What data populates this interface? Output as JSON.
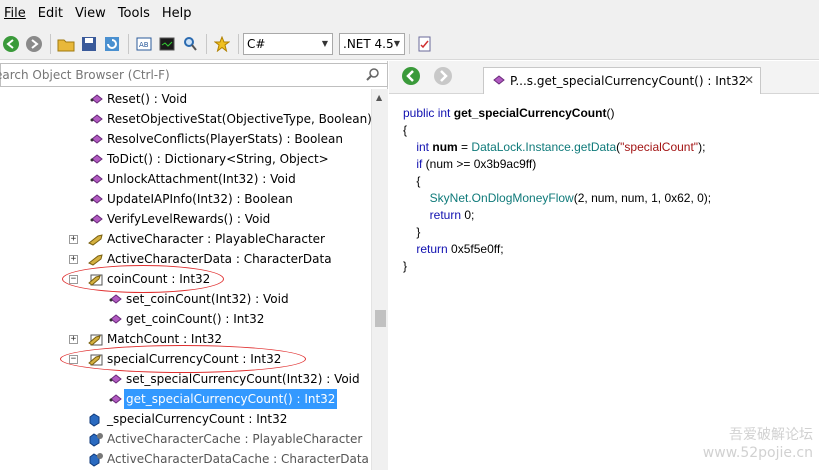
{
  "menubar": {
    "items": [
      "File",
      "Edit",
      "View",
      "Tools",
      "Help"
    ]
  },
  "toolbar": {
    "language": "C#",
    "framework": ".NET 4.5"
  },
  "search": {
    "placeholder": "earch Object Browser (Ctrl-F)"
  },
  "tree": {
    "items": [
      {
        "label": "Reset() : Void"
      },
      {
        "label": "ResetObjectiveStat(ObjectiveType, Boolean) :"
      },
      {
        "label": "ResolveConflicts(PlayerStats) : Boolean"
      },
      {
        "label": "ToDict() : Dictionary<String, Object>"
      },
      {
        "label": "UnlockAttachment(Int32) : Void"
      },
      {
        "label": "UpdateIAPInfo(Int32) : Boolean"
      },
      {
        "label": "VerifyLevelRewards() : Void"
      },
      {
        "label": "ActiveCharacter : PlayableCharacter"
      },
      {
        "label": "ActiveCharacterData : CharacterData"
      },
      {
        "label": "coinCount : Int32"
      },
      {
        "label": "set_coinCount(Int32) : Void"
      },
      {
        "label": "get_coinCount() : Int32"
      },
      {
        "label": "MatchCount : Int32"
      },
      {
        "label": "specialCurrencyCount : Int32"
      },
      {
        "label": "set_specialCurrencyCount(Int32) : Void"
      },
      {
        "label": "get_specialCurrencyCount() : Int32"
      },
      {
        "label": "_specialCurrencyCount : Int32"
      },
      {
        "label": "ActiveCharacterCache : PlayableCharacter"
      },
      {
        "label": "ActiveCharacterDataCache : CharacterData"
      }
    ]
  },
  "tab": {
    "title": "P...s.get_specialCurrencyCount() : Int32"
  },
  "code": {
    "l1": {
      "kw1": "public",
      "kw2": "int",
      "name": "get_specialCurrencyCount",
      "rest": "()"
    },
    "l2": "{",
    "l3": {
      "kw": "int",
      "var": "num",
      "eq": " = ",
      "cls": "DataLock.Instance.getData",
      "open": "(",
      "str": "\"specialCount\"",
      "close": ");"
    },
    "l4": {
      "kw": "if",
      "rest": " (num >= 0x3b9ac9ff)"
    },
    "l5": "{",
    "l6": {
      "cls": "SkyNet.OnDlogMoneyFlow",
      "rest": "(2, num, num, 1, 0x62, 0);"
    },
    "l7": {
      "kw": "return",
      "rest": " 0;"
    },
    "l8": "}",
    "l9": {
      "kw": "return",
      "rest": " 0x5f5e0ff;"
    },
    "l10": "}"
  },
  "watermark": {
    "line1": "吾爱破解论坛",
    "line2": "www.52pojie.cn"
  },
  "colors": {
    "selection": "#3399ff",
    "annotation": "#e03030",
    "keyword": "#1010b0",
    "type": "#0f7a7a",
    "string": "#a31515"
  }
}
